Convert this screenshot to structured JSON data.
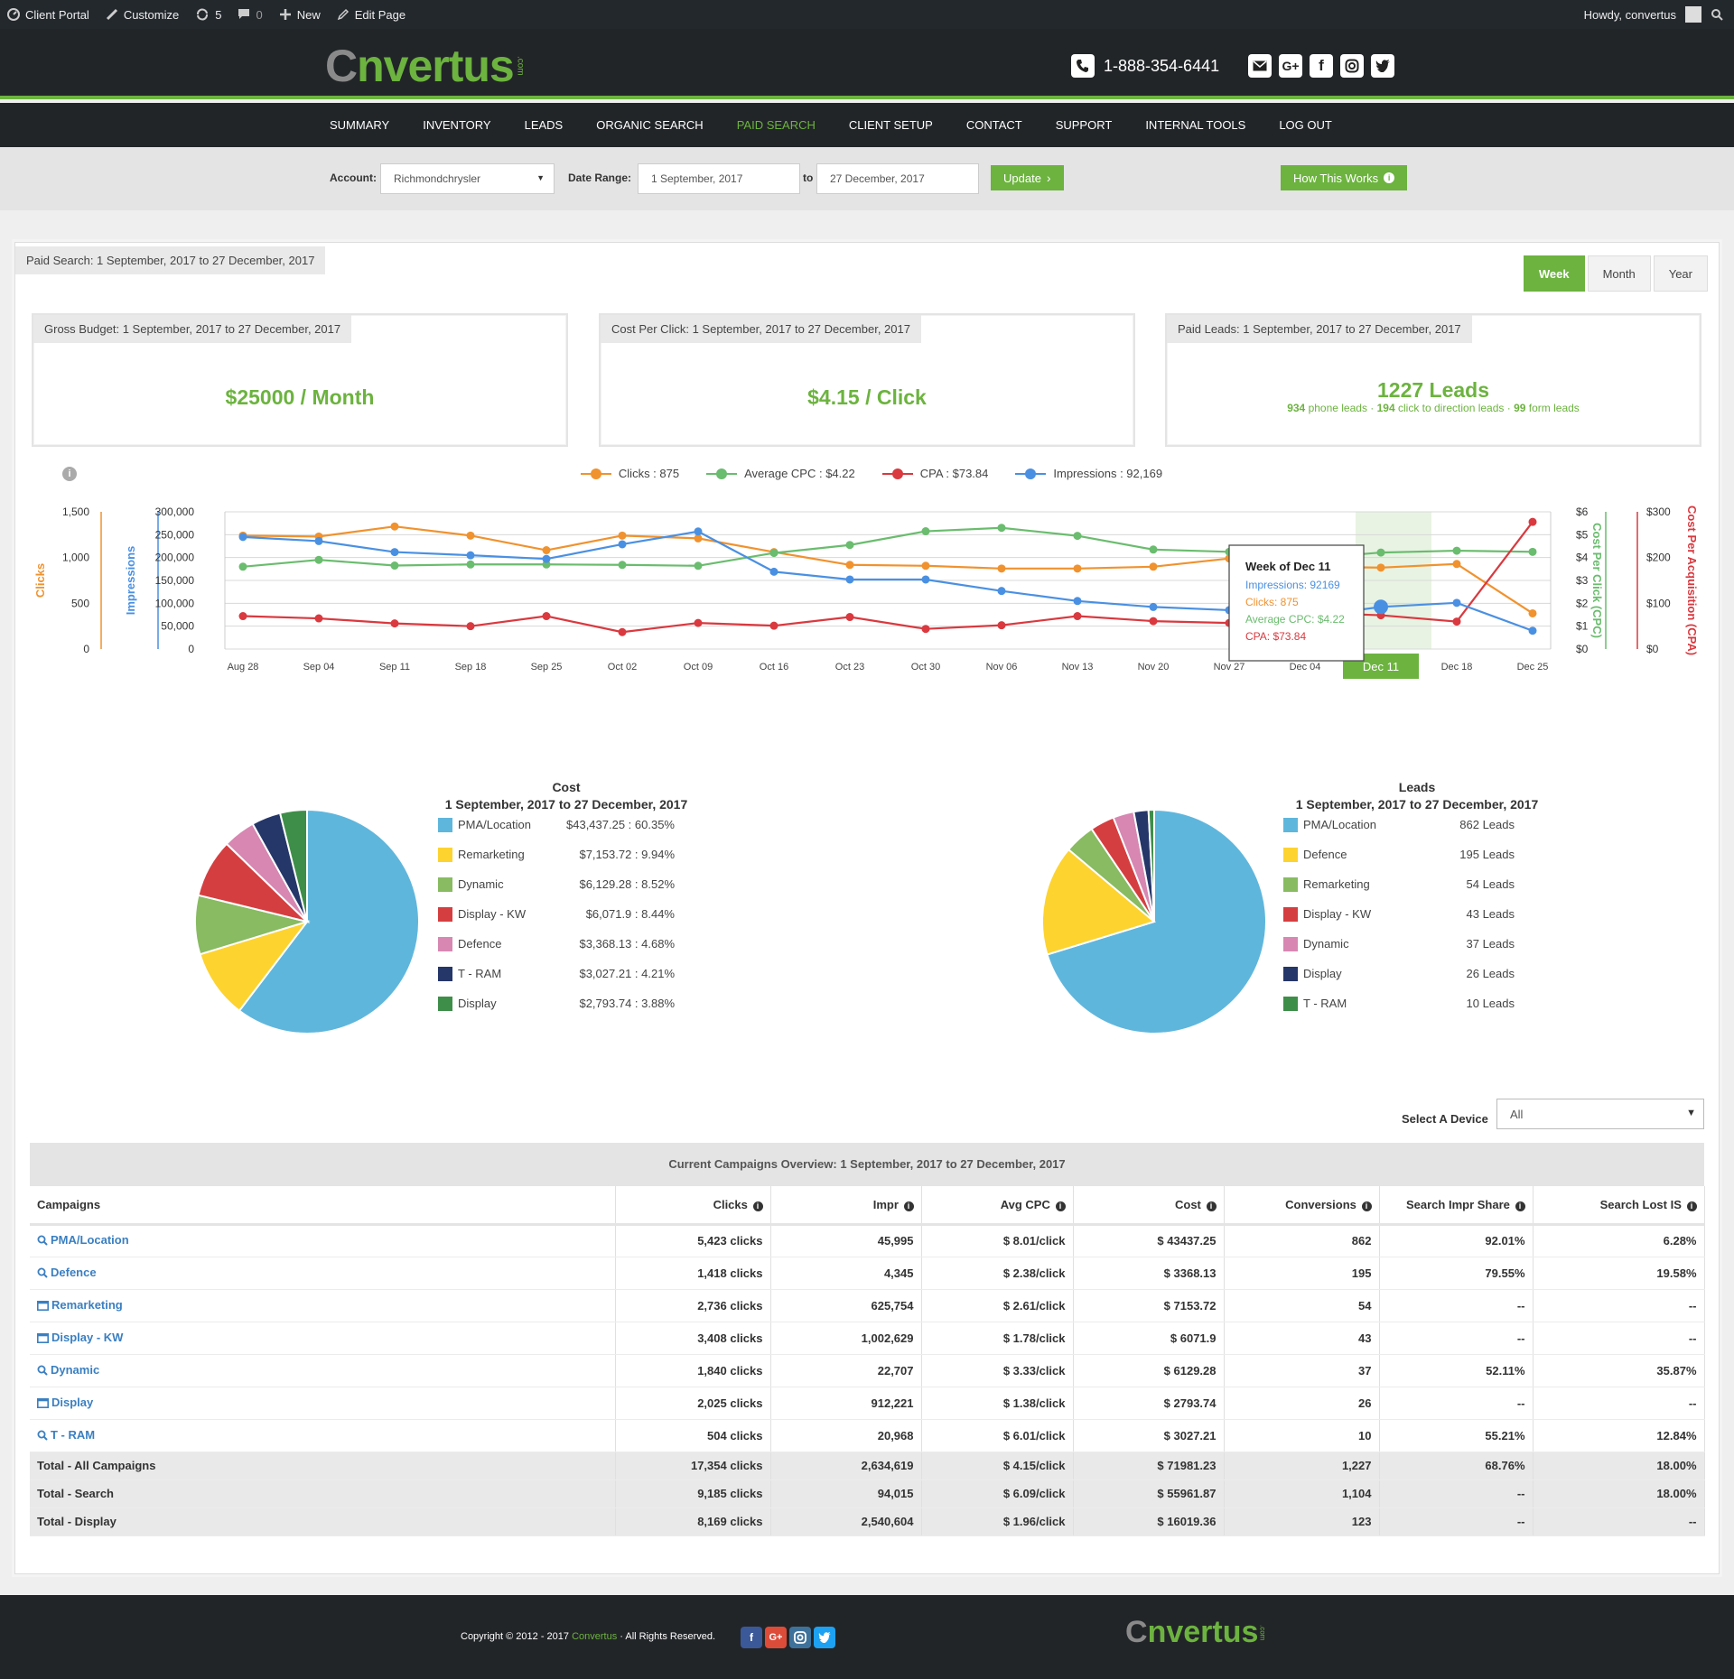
{
  "adminbar": {
    "site": "Client Portal",
    "customize": "Customize",
    "updates": "5",
    "comments": "0",
    "new": "New",
    "edit": "Edit Page",
    "howdy": "Howdy, convertus"
  },
  "header": {
    "logo_c": "C",
    "logo_rest": "nvertus",
    "logo_dotcom": ".com",
    "phone": "1-888-354-6441"
  },
  "nav": {
    "items": [
      "SUMMARY",
      "INVENTORY",
      "LEADS",
      "ORGANIC SEARCH",
      "PAID SEARCH",
      "CLIENT SETUP",
      "CONTACT",
      "SUPPORT",
      "INTERNAL TOOLS",
      "LOG OUT"
    ],
    "active": "PAID SEARCH"
  },
  "filters": {
    "account_label": "Account:",
    "account_value": "Richmondchrysler",
    "date_label": "Date Range:",
    "date_from": "1 September, 2017",
    "to_label": "to",
    "date_to": "27 December, 2017",
    "update_label": "Update",
    "how_label": "How This Works"
  },
  "panel": {
    "title": "Paid Search: 1 September, 2017 to 27 December, 2017",
    "periods": [
      "Week",
      "Month",
      "Year"
    ],
    "active_period": "Week"
  },
  "cards": {
    "budget": {
      "title": "Gross Budget: 1 September, 2017 to 27 December, 2017",
      "value": "$25000 / Month"
    },
    "cpc": {
      "title": "Cost Per Click: 1 September, 2017 to 27 December, 2017",
      "value": "$4.15 / Click"
    },
    "leads": {
      "title": "Paid Leads: 1 September, 2017 to 27 December, 2017",
      "value": "1227 Leads",
      "phone_n": "934",
      "phone_t": "phone leads",
      "dir_n": "194",
      "dir_t": "click to direction leads",
      "form_n": "99",
      "form_t": "form leads",
      "sep": " · "
    }
  },
  "chart_data": [
    {
      "type": "line",
      "x": [
        "Aug 28",
        "Sep 04",
        "Sep 11",
        "Sep 18",
        "Sep 25",
        "Oct 02",
        "Oct 09",
        "Oct 16",
        "Oct 23",
        "Oct 30",
        "Nov 06",
        "Nov 13",
        "Nov 20",
        "Nov 27",
        "Dec 04",
        "Dec 11",
        "Dec 18",
        "Dec 25"
      ],
      "series": [
        {
          "name": "Clicks",
          "legend": "Clicks : 875",
          "color": "#f0922e",
          "axis": "clicks",
          "values": [
            1240,
            1230,
            1340,
            1240,
            1080,
            1240,
            1210,
            1060,
            920,
            910,
            880,
            880,
            900,
            990,
            900,
            890,
            930,
            390
          ]
        },
        {
          "name": "Average CPC",
          "legend": "Average CPC : $4.22",
          "color": "#6abc6e",
          "axis": "cpc",
          "values": [
            3.6,
            3.9,
            3.65,
            3.7,
            3.7,
            3.68,
            3.64,
            4.2,
            4.55,
            5.15,
            5.3,
            4.95,
            4.35,
            4.25,
            3.95,
            4.22,
            4.3,
            4.25
          ]
        },
        {
          "name": "CPA",
          "legend": "CPA : $73.84",
          "color": "#d9393f",
          "axis": "cpa",
          "values": [
            72,
            67,
            56,
            50,
            72,
            37,
            57,
            51,
            70,
            44,
            52,
            72,
            61,
            57,
            80,
            73.84,
            60,
            278
          ]
        },
        {
          "name": "Impressions",
          "legend": "Impressions : 92,169",
          "color": "#4a90e2",
          "axis": "impr",
          "values": [
            245000,
            236000,
            212000,
            205000,
            197000,
            229000,
            257000,
            169000,
            152000,
            152000,
            127000,
            105000,
            92000,
            85000,
            70000,
            92169,
            101000,
            40000
          ]
        }
      ],
      "axes": {
        "clicks": {
          "label": "Clicks",
          "range": [
            0,
            1500
          ],
          "ticks": [
            "0",
            "500",
            "1,000",
            "1,500"
          ]
        },
        "impr": {
          "label": "Impressions",
          "range": [
            0,
            300000
          ],
          "ticks": [
            "0",
            "50,000",
            "100,000",
            "150,000",
            "200,000",
            "250,000",
            "300,000"
          ]
        },
        "cpc": {
          "label": "Cost Per Click (CPC)",
          "range": [
            0,
            6
          ],
          "ticks": [
            "$0",
            "$1",
            "$2",
            "$3",
            "$4",
            "$5",
            "$6"
          ]
        },
        "cpa": {
          "label": "Cost Per Acquisition (CPA)",
          "range": [
            0,
            300
          ],
          "ticks": [
            "$0",
            "$100",
            "$200",
            "$300"
          ]
        }
      },
      "highlight_index": 15,
      "tooltip": {
        "title": "Week of Dec 11",
        "lines": [
          "Impressions: 92169",
          "Clicks: 875",
          "Average CPC: $4.22",
          "CPA: $73.84"
        ]
      }
    },
    {
      "type": "pie",
      "title": "Cost",
      "subtitle": "1 September, 2017 to 27 December, 2017",
      "slices": [
        {
          "name": "PMA/Location",
          "value": 43437.25,
          "label": "$43,437.25 : 60.35%",
          "color": "#5fb6dc"
        },
        {
          "name": "Remarketing",
          "value": 7153.72,
          "label": "$7,153.72 : 9.94%",
          "color": "#fdd330"
        },
        {
          "name": "Dynamic",
          "value": 6129.28,
          "label": "$6,129.28 : 8.52%",
          "color": "#88bb62"
        },
        {
          "name": "Display - KW",
          "value": 6071.9,
          "label": "$6,071.9 : 8.44%",
          "color": "#d53e40"
        },
        {
          "name": "Defence",
          "value": 3368.13,
          "label": "$3,368.13 : 4.68%",
          "color": "#d787b2"
        },
        {
          "name": "T - RAM",
          "value": 3027.21,
          "label": "$3,027.21 : 4.21%",
          "color": "#253669"
        },
        {
          "name": "Display",
          "value": 2793.74,
          "label": "$2,793.74 : 3.88%",
          "color": "#3e8e49"
        }
      ]
    },
    {
      "type": "pie",
      "title": "Leads",
      "subtitle": "1 September, 2017 to 27 December, 2017",
      "slices": [
        {
          "name": "PMA/Location",
          "value": 862,
          "label": "862 Leads",
          "color": "#5fb6dc"
        },
        {
          "name": "Defence",
          "value": 195,
          "label": "195 Leads",
          "color": "#fdd330"
        },
        {
          "name": "Remarketing",
          "value": 54,
          "label": "54 Leads",
          "color": "#88bb62"
        },
        {
          "name": "Display - KW",
          "value": 43,
          "label": "43 Leads",
          "color": "#d53e40"
        },
        {
          "name": "Dynamic",
          "value": 37,
          "label": "37 Leads",
          "color": "#d787b2"
        },
        {
          "name": "Display",
          "value": 26,
          "label": "26 Leads",
          "color": "#253669"
        },
        {
          "name": "T - RAM",
          "value": 10,
          "label": "10 Leads",
          "color": "#3e8e49"
        }
      ]
    }
  ],
  "device": {
    "label": "Select A Device",
    "value": "All"
  },
  "campaigns": {
    "title": "Current Campaigns Overview: 1 September, 2017 to 27 December, 2017",
    "headers": [
      "Campaigns",
      "Clicks",
      "Impr",
      "Avg CPC",
      "Cost",
      "Conversions",
      "Search Impr Share",
      "Search Lost IS"
    ],
    "rows": [
      {
        "icon": "search",
        "cells": [
          "PMA/Location",
          "5,423 clicks",
          "45,995",
          "$ 8.01/click",
          "$ 43437.25",
          "862",
          "92.01%",
          "6.28%"
        ]
      },
      {
        "icon": "search",
        "cells": [
          "Defence",
          "1,418 clicks",
          "4,345",
          "$ 2.38/click",
          "$ 3368.13",
          "195",
          "79.55%",
          "19.58%"
        ]
      },
      {
        "icon": "display",
        "cells": [
          "Remarketing",
          "2,736 clicks",
          "625,754",
          "$ 2.61/click",
          "$ 7153.72",
          "54",
          "--",
          "--"
        ]
      },
      {
        "icon": "display",
        "cells": [
          "Display - KW",
          "3,408 clicks",
          "1,002,629",
          "$ 1.78/click",
          "$ 6071.9",
          "43",
          "--",
          "--"
        ]
      },
      {
        "icon": "search",
        "cells": [
          "Dynamic",
          "1,840 clicks",
          "22,707",
          "$ 3.33/click",
          "$ 6129.28",
          "37",
          "52.11%",
          "35.87%"
        ]
      },
      {
        "icon": "display",
        "cells": [
          "Display",
          "2,025 clicks",
          "912,221",
          "$ 1.38/click",
          "$ 2793.74",
          "26",
          "--",
          "--"
        ]
      },
      {
        "icon": "search",
        "cells": [
          "T - RAM",
          "504 clicks",
          "20,968",
          "$ 6.01/click",
          "$ 3027.21",
          "10",
          "55.21%",
          "12.84%"
        ]
      }
    ],
    "totals": [
      [
        "Total - All Campaigns",
        "17,354 clicks",
        "2,634,619",
        "$ 4.15/click",
        "$ 71981.23",
        "1,227",
        "68.76%",
        "18.00%"
      ],
      [
        "Total - Search",
        "9,185 clicks",
        "94,015",
        "$ 6.09/click",
        "$ 55961.87",
        "1,104",
        "--",
        "18.00%"
      ],
      [
        "Total - Display",
        "8,169 clicks",
        "2,540,604",
        "$ 1.96/click",
        "$ 16019.36",
        "123",
        "--",
        "--"
      ]
    ]
  },
  "footer": {
    "copy_pre": "Copyright © 2012 - 2017",
    "copy_brand": "Convertus",
    "copy_post": "· All Rights Reserved.",
    "social": [
      "f",
      "G+",
      "ig",
      "tw"
    ]
  },
  "colors": {
    "brand_green": "#6cb33f",
    "dark": "#222528",
    "link_blue": "#3a7fc1"
  }
}
